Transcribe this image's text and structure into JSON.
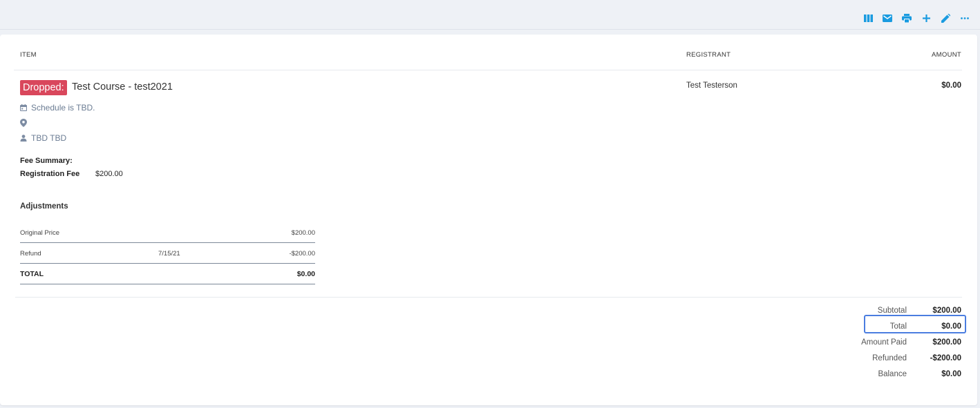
{
  "toolbar": {
    "icons": [
      "columns-icon",
      "email-icon",
      "print-icon",
      "add-icon",
      "edit-icon",
      "more-icon"
    ],
    "accent": "#1a9be0"
  },
  "columns": {
    "item": "ITEM",
    "registrant": "REGISTRANT",
    "amount": "AMOUNT"
  },
  "line_item": {
    "status": "Dropped:",
    "status_color": "#d9475c",
    "course": "Test Course - test2021",
    "schedule": "Schedule is TBD.",
    "location": "",
    "instructor": "TBD TBD",
    "registrant": "Test Testerson",
    "amount": "$0.00"
  },
  "fee_summary": {
    "title": "Fee Summary:",
    "label": "Registration Fee",
    "value": "$200.00"
  },
  "adjustments": {
    "title": "Adjustments",
    "rows": [
      {
        "label": "Original Price",
        "date": "",
        "amount": "$200.00"
      },
      {
        "label": "Refund",
        "date": "7/15/21",
        "amount": "-$200.00"
      }
    ],
    "total_label": "TOTAL",
    "total_amount": "$0.00"
  },
  "summary": {
    "subtotal_label": "Subtotal",
    "subtotal": "$200.00",
    "total_label": "Total",
    "total": "$0.00",
    "paid_label": "Amount Paid",
    "paid": "$200.00",
    "refunded_label": "Refunded",
    "refunded": "-$200.00",
    "balance_label": "Balance",
    "balance": "$0.00"
  }
}
